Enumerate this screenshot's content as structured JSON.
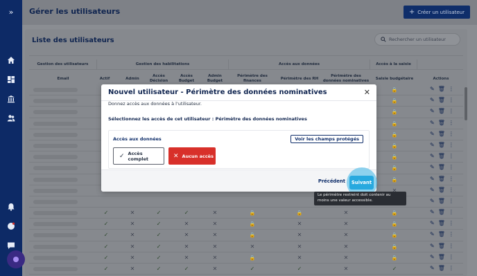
{
  "header": {
    "title": "Gérer les utilisateurs",
    "create_button": "Créer un utilisateur"
  },
  "list": {
    "title": "Liste des utilisateurs",
    "search_placeholder": "Rechercher un utilisateur"
  },
  "table": {
    "groups": [
      "Gestion des utilisateurs",
      "Gestion des habilitations",
      "Accès aux données",
      "Accès à la saisie"
    ],
    "columns": [
      "Email",
      "Actif",
      "Admin",
      "Accès Décision",
      "Accès Budget",
      "Admin Budget",
      "Périmètre des finances",
      "Périmètre des RH",
      "Périmètre des données nominatives",
      "Saisie budgétaire",
      "Actions"
    ],
    "rows": [
      [
        "",
        "",
        "",
        "",
        "",
        "",
        "lock",
        "",
        "",
        "lock",
        ""
      ],
      [
        "",
        "",
        "",
        "",
        "",
        "",
        "",
        "",
        "",
        "lock",
        ""
      ],
      [
        "",
        "",
        "",
        "",
        "",
        "",
        "",
        "",
        "",
        "lock",
        ""
      ],
      [
        "",
        "",
        "",
        "",
        "",
        "",
        "",
        "",
        "",
        "lock",
        ""
      ],
      [
        "",
        "",
        "",
        "",
        "",
        "",
        "",
        "",
        "",
        "lock",
        ""
      ],
      [
        "",
        "",
        "",
        "",
        "",
        "",
        "",
        "",
        "",
        "lock",
        ""
      ],
      [
        "",
        "",
        "",
        "",
        "",
        "",
        "",
        "",
        "",
        "lock",
        ""
      ],
      [
        "",
        "",
        "",
        "",
        "",
        "",
        "",
        "",
        "",
        "lock",
        ""
      ],
      [
        "",
        "",
        "",
        "",
        "",
        "",
        "",
        "",
        "",
        "lock",
        ""
      ],
      [
        "",
        "",
        "",
        "",
        "",
        "",
        "",
        "",
        "",
        "no",
        ""
      ],
      [
        "",
        "",
        "",
        "",
        "",
        "",
        "",
        "",
        "",
        "",
        ""
      ],
      [
        "",
        "ok",
        "no",
        "ok",
        "ok",
        "no",
        "lock",
        "lock",
        "no",
        "lock",
        ""
      ],
      [
        "",
        "ok",
        "no",
        "ok",
        "no",
        "no",
        "lock",
        "no",
        "no",
        "lock",
        ""
      ],
      [
        "",
        "ok",
        "no",
        "ok",
        "no",
        "no",
        "lock",
        "no",
        "no",
        "lock",
        ""
      ],
      [
        "",
        "ok",
        "no",
        "ok",
        "no",
        "no",
        "no",
        "no",
        "no",
        "lock",
        ""
      ],
      [
        "",
        "ok",
        "no",
        "ok",
        "no",
        "no",
        "lock",
        "no",
        "no",
        "lock",
        ""
      ],
      [
        "",
        "ok",
        "no",
        "ok",
        "ok",
        "no",
        "ok",
        "ok",
        "no",
        "ok",
        ""
      ]
    ]
  },
  "modal": {
    "title": "Nouvel utilisateur - Périmètre des données nominatives",
    "description": "Donnez accès aux données à l'utilisateur.",
    "subtitle": "Sélectionnez les accès de cet utilisateur : Périmètre des données nominatives",
    "section_label": "Accès aux données",
    "protected_fields_button": "Voir les champs protégés",
    "option_full": "Accès complet",
    "option_none": "Aucun accès",
    "previous": "Précédent",
    "next": "Suivant"
  },
  "tooltip": "Le périmètre restreint doit contenir au moins une valeur accessible.",
  "icons": [
    "chevrons-right-icon",
    "home-icon",
    "dashboard-icon",
    "bank-icon",
    "users-icon",
    "bell-icon",
    "help-icon",
    "chat-icon"
  ],
  "colors": {
    "primary": "#0f2e6a",
    "danger": "#d8302a",
    "accent": "#27a9df"
  }
}
